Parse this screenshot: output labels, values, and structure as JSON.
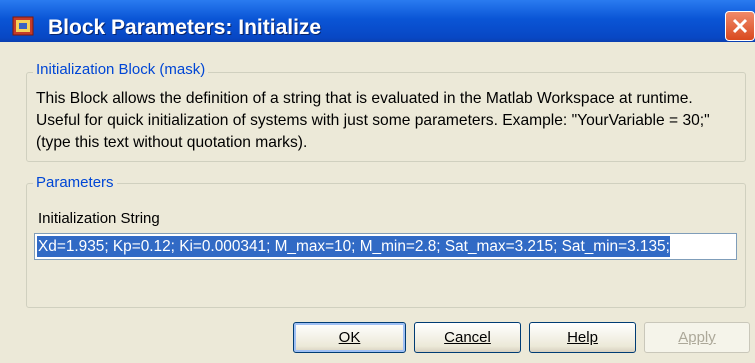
{
  "window": {
    "title": "Block Parameters: Initialize"
  },
  "mask_group": {
    "label": "Initialization Block (mask)",
    "description_line1": "This Block allows the definition of a string that is evaluated in the Matlab Workspace at runtime.",
    "description_line2": "Useful for quick initialization of systems with just some parameters. Example: \"YourVariable = 30;\"",
    "description_line3": "(type this text without quotation marks)."
  },
  "parameters_group": {
    "label": "Parameters",
    "field_label": "Initialization String",
    "field_value": "Xd=1.935; Kp=0.12; Ki=0.000341; M_max=10; M_min=2.8; Sat_max=3.215; Sat_min=3.135;"
  },
  "buttons": {
    "ok_label": "OK",
    "cancel_label": "Cancel",
    "help_label": "Help",
    "apply_label": "Apply"
  },
  "icons": {
    "app": "simulink-block-icon",
    "close": "close-icon"
  },
  "colors": {
    "titlebar": "#0a55d6",
    "group_label": "#0046d5",
    "selection": "#316ac5",
    "dialog_bg": "#ece9d8"
  }
}
